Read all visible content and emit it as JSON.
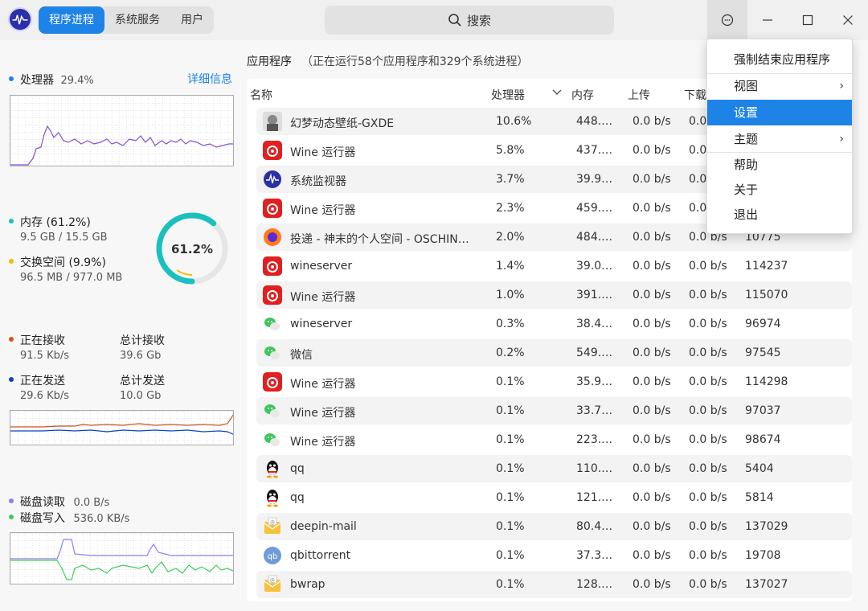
{
  "header": {
    "tabs": [
      "程序进程",
      "系统服务",
      "用户"
    ],
    "active_tab": 0,
    "search_label": "搜索"
  },
  "cpu": {
    "label": "处理器",
    "value": "29.4%",
    "details_link": "详细信息"
  },
  "memory": {
    "label": "内存 (61.2%)",
    "value": "9.5 GB / 15.5 GB",
    "swap_label": "交换空间 (9.9%)",
    "swap_value": "96.5 MB / 977.0 MB",
    "gauge_text": "61.2%",
    "gauge_fraction": 0.612
  },
  "network": {
    "recv_label": "正在接收",
    "recv_value": "91.5 Kb/s",
    "recv_total_label": "总计接收",
    "recv_total_value": "39.6 Gb",
    "send_label": "正在发送",
    "send_value": "29.6 Kb/s",
    "send_total_label": "总计发送",
    "send_total_value": "10.0 Gb"
  },
  "disk": {
    "read_label": "磁盘读取",
    "read_value": "0.0 B/s",
    "write_label": "磁盘写入",
    "write_value": "536.0 KB/s"
  },
  "process_panel": {
    "title": "应用程序",
    "subtitle": "（正在运行58个应用程序和329个系统进程）",
    "columns": {
      "name": "名称",
      "cpu": "处理器",
      "mem": "内存",
      "up": "上传",
      "down": "下载"
    }
  },
  "rows": [
    {
      "icon": "wallpaper-icon",
      "name": "幻梦动态壁纸-GXDE",
      "cpu": "10.6%",
      "mem": "448.…",
      "up": "0.0 b/s",
      "down": "0.0 b/s",
      "pid": ""
    },
    {
      "icon": "netease-music-icon",
      "name": "Wine 运行器",
      "cpu": "5.8%",
      "mem": "437.…",
      "up": "0.0 b/s",
      "down": "0.0 b/s",
      "pid": ""
    },
    {
      "icon": "system-monitor-icon",
      "name": "系统监视器",
      "cpu": "3.7%",
      "mem": "39.9 …",
      "up": "0.0 b/s",
      "down": "0.0",
      "pid": ""
    },
    {
      "icon": "netease-music-icon",
      "name": "Wine 运行器",
      "cpu": "2.3%",
      "mem": "459.…",
      "up": "0.0 b/s",
      "down": "0.0",
      "pid": ""
    },
    {
      "icon": "firefox-icon",
      "name": "投递 - 神末的个人空间 - OSCHIN…",
      "cpu": "2.0%",
      "mem": "484.…",
      "up": "0.0 b/s",
      "down": "0.0 b/s",
      "pid": "10775"
    },
    {
      "icon": "netease-music-icon",
      "name": "wineserver",
      "cpu": "1.4%",
      "mem": "39.0 …",
      "up": "0.0 b/s",
      "down": "0.0 b/s",
      "pid": "114237"
    },
    {
      "icon": "netease-music-icon",
      "name": "Wine 运行器",
      "cpu": "1.0%",
      "mem": "391.…",
      "up": "0.0 b/s",
      "down": "0.0 b/s",
      "pid": "115070"
    },
    {
      "icon": "wechat-icon",
      "name": "wineserver",
      "cpu": "0.3%",
      "mem": "38.4 …",
      "up": "0.0 b/s",
      "down": "0.0 b/s",
      "pid": "96974"
    },
    {
      "icon": "wechat-icon",
      "name": "微信",
      "cpu": "0.2%",
      "mem": "549.…",
      "up": "0.0 b/s",
      "down": "0.0 b/s",
      "pid": "97545"
    },
    {
      "icon": "netease-music-icon",
      "name": "Wine 运行器",
      "cpu": "0.1%",
      "mem": "35.9 …",
      "up": "0.0 b/s",
      "down": "0.0 b/s",
      "pid": "114298"
    },
    {
      "icon": "wechat-icon",
      "name": "Wine 运行器",
      "cpu": "0.1%",
      "mem": "33.7 …",
      "up": "0.0 b/s",
      "down": "0.0 b/s",
      "pid": "97037"
    },
    {
      "icon": "wechat-icon",
      "name": "Wine 运行器",
      "cpu": "0.1%",
      "mem": "223.…",
      "up": "0.0 b/s",
      "down": "0.0 b/s",
      "pid": "98674"
    },
    {
      "icon": "qq-icon",
      "name": "qq",
      "cpu": "0.1%",
      "mem": "110.…",
      "up": "0.0 b/s",
      "down": "0.0 b/s",
      "pid": "5404"
    },
    {
      "icon": "qq-icon",
      "name": "qq",
      "cpu": "0.1%",
      "mem": "121.…",
      "up": "0.0 b/s",
      "down": "0.0 b/s",
      "pid": "5814"
    },
    {
      "icon": "mail-icon",
      "name": "deepin-mail",
      "cpu": "0.1%",
      "mem": "80.4 …",
      "up": "0.0 b/s",
      "down": "0.0 b/s",
      "pid": "137029"
    },
    {
      "icon": "qbittorrent-icon",
      "name": "qbittorrent",
      "cpu": "0.1%",
      "mem": "37.3 …",
      "up": "0.0 b/s",
      "down": "0.0 b/s",
      "pid": "19708"
    },
    {
      "icon": "mail-icon",
      "name": "bwrap",
      "cpu": "0.1%",
      "mem": "128.…",
      "up": "0.0 b/s",
      "down": "0.0 b/s",
      "pid": "137027"
    }
  ],
  "context_menu": {
    "items": [
      {
        "label": "强制结束应用程序",
        "submenu": false,
        "highlighted": false
      },
      {
        "label": "视图",
        "submenu": true,
        "highlighted": false
      },
      {
        "label": "设置",
        "submenu": false,
        "highlighted": true
      },
      {
        "label": "主题",
        "submenu": true,
        "highlighted": false
      },
      {
        "label": "帮助",
        "submenu": false,
        "highlighted": false
      },
      {
        "label": "关于",
        "submenu": false,
        "highlighted": false
      },
      {
        "label": "退出",
        "submenu": false,
        "highlighted": false
      }
    ]
  },
  "colors": {
    "accent": "#1e83e6",
    "cpu_dot": "#1e83e6",
    "mem_dot": "#1ac0c0",
    "swap_dot": "#f0c000",
    "recv_dot": "#e0501a",
    "send_dot": "#1040c0",
    "disk_read_dot": "#8c7ff0",
    "disk_write_dot": "#3ccc5a"
  }
}
